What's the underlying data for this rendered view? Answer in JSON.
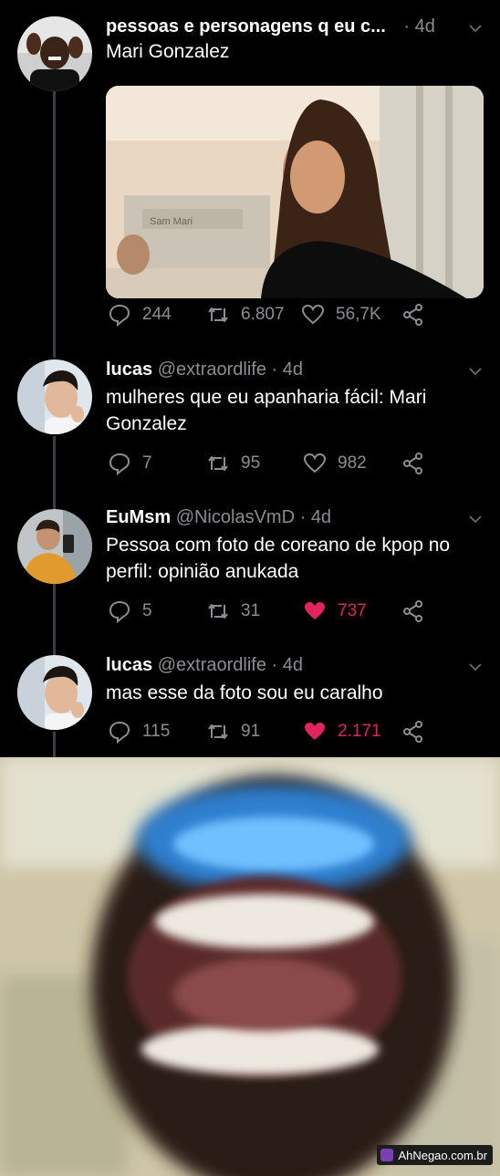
{
  "tweets": [
    {
      "author_name": "pessoas e personagens q eu c...",
      "handle": "",
      "time": "4d",
      "text": "Mari Gonzalez",
      "replies": "244",
      "retweets": "6.807",
      "likes": "56,7K",
      "liked": false
    },
    {
      "author_name": "lucas",
      "handle": "@extraordlife",
      "time": "4d",
      "text": "mulheres que eu apanharia fácil: Mari Gonzalez",
      "replies": "7",
      "retweets": "95",
      "likes": "982",
      "liked": false
    },
    {
      "author_name": "EuMsm",
      "handle": "@NicolasVmD",
      "time": "4d",
      "text": "Pessoa com foto de coreano de kpop no perfil: opinião anukada",
      "replies": "5",
      "retweets": "31",
      "likes": "737",
      "liked": true
    },
    {
      "author_name": "lucas",
      "handle": "@extraordlife",
      "time": "4d",
      "text": "mas esse da foto sou eu caralho",
      "replies": "115",
      "retweets": "91",
      "likes": "2.171",
      "liked": true
    }
  ],
  "separator": "·",
  "media_sign_text": "Sam Mari",
  "watermark": "AhNegao.com.br",
  "icons": {
    "reply": "reply-icon",
    "retweet": "retweet-icon",
    "like": "heart-icon",
    "share": "share-icon",
    "menu": "chevron-down-icon"
  },
  "colors": {
    "background": "#000000",
    "text": "#ffffff",
    "muted": "#8a8d91",
    "like_active": "#e0245e",
    "thread_line": "#3a3d42"
  }
}
